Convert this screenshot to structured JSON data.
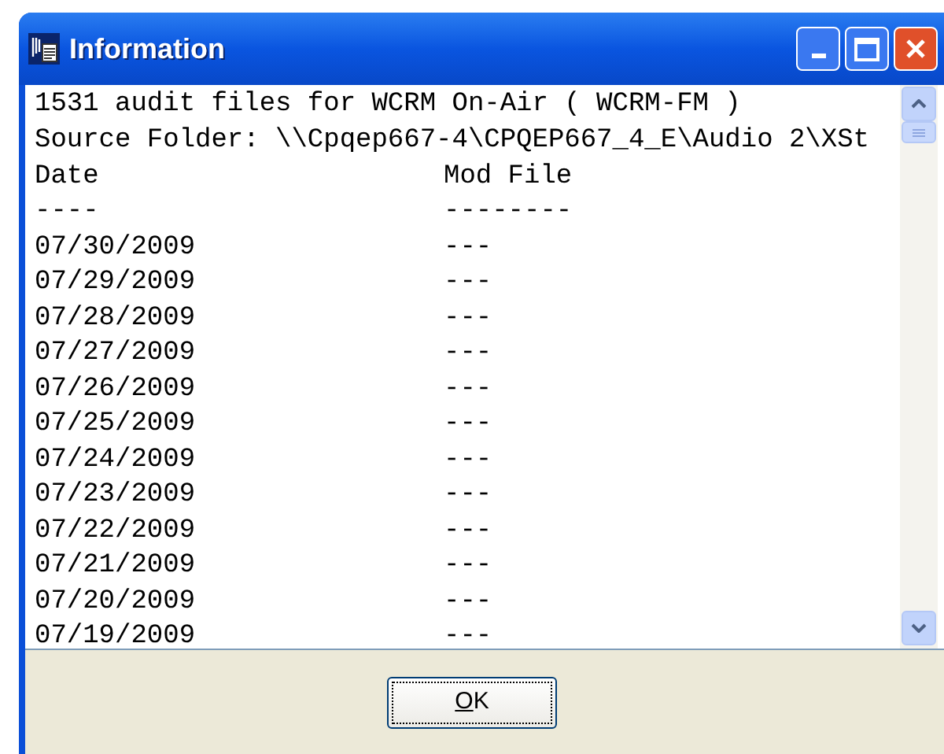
{
  "window": {
    "title": "Information"
  },
  "content": {
    "summary": "1531 audit files for WCRM On-Air ( WCRM-FM )",
    "source": "Source Folder: \\\\Cpqep667-4\\CPQEP667_4_E\\Audio 2\\XSt",
    "columns": [
      "Date",
      "Mod File"
    ],
    "separators": [
      "----",
      "--------"
    ],
    "rows": [
      [
        "07/30/2009",
        "---"
      ],
      [
        "07/29/2009",
        "---"
      ],
      [
        "07/28/2009",
        "---"
      ],
      [
        "07/27/2009",
        "---"
      ],
      [
        "07/26/2009",
        "---"
      ],
      [
        "07/25/2009",
        "---"
      ],
      [
        "07/24/2009",
        "---"
      ],
      [
        "07/23/2009",
        "---"
      ],
      [
        "07/22/2009",
        "---"
      ],
      [
        "07/21/2009",
        "---"
      ],
      [
        "07/20/2009",
        "---"
      ],
      [
        "07/19/2009",
        "---"
      ]
    ]
  },
  "buttons": [
    {
      "label_underlined": "O",
      "label_rest": "K"
    }
  ]
}
